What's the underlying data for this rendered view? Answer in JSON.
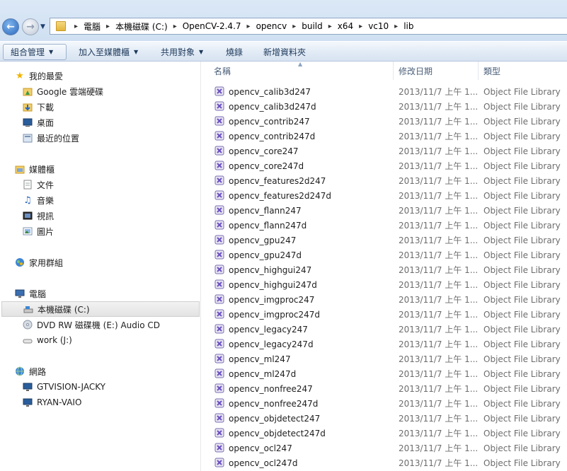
{
  "breadcrumb": [
    "電腦",
    "本機磁碟 (C:)",
    "OpenCV-2.4.7",
    "opencv",
    "build",
    "x64",
    "vc10",
    "lib"
  ],
  "toolbar": {
    "organize": "組合管理",
    "add_to_library": "加入至媒體櫃",
    "share_with": "共用對象",
    "burn": "燒錄",
    "new_folder": "新增資料夾"
  },
  "nav": {
    "favorites": {
      "label": "我的最愛",
      "items": [
        "Google 雲端硬碟",
        "下載",
        "桌面",
        "最近的位置"
      ]
    },
    "libraries": {
      "label": "媒體櫃",
      "items": [
        "文件",
        "音樂",
        "視訊",
        "圖片"
      ]
    },
    "homegroup": {
      "label": "家用群組"
    },
    "computer": {
      "label": "電腦",
      "items": [
        "本機磁碟 (C:)",
        "DVD RW 磁碟機 (E:) Audio CD",
        "work (J:)"
      ]
    },
    "network": {
      "label": "網路",
      "items": [
        "GTVISION-JACKY",
        "RYAN-VAIO"
      ]
    }
  },
  "columns": {
    "name": "名稱",
    "date": "修改日期",
    "type": "類型"
  },
  "files": [
    {
      "name": "opencv_calib3d247",
      "date": "2013/11/7 上午 1...",
      "type": "Object File Library"
    },
    {
      "name": "opencv_calib3d247d",
      "date": "2013/11/7 上午 1...",
      "type": "Object File Library"
    },
    {
      "name": "opencv_contrib247",
      "date": "2013/11/7 上午 1...",
      "type": "Object File Library"
    },
    {
      "name": "opencv_contrib247d",
      "date": "2013/11/7 上午 1...",
      "type": "Object File Library"
    },
    {
      "name": "opencv_core247",
      "date": "2013/11/7 上午 1...",
      "type": "Object File Library"
    },
    {
      "name": "opencv_core247d",
      "date": "2013/11/7 上午 1...",
      "type": "Object File Library"
    },
    {
      "name": "opencv_features2d247",
      "date": "2013/11/7 上午 1...",
      "type": "Object File Library"
    },
    {
      "name": "opencv_features2d247d",
      "date": "2013/11/7 上午 1...",
      "type": "Object File Library"
    },
    {
      "name": "opencv_flann247",
      "date": "2013/11/7 上午 1...",
      "type": "Object File Library"
    },
    {
      "name": "opencv_flann247d",
      "date": "2013/11/7 上午 1...",
      "type": "Object File Library"
    },
    {
      "name": "opencv_gpu247",
      "date": "2013/11/7 上午 1...",
      "type": "Object File Library"
    },
    {
      "name": "opencv_gpu247d",
      "date": "2013/11/7 上午 1...",
      "type": "Object File Library"
    },
    {
      "name": "opencv_highgui247",
      "date": "2013/11/7 上午 1...",
      "type": "Object File Library"
    },
    {
      "name": "opencv_highgui247d",
      "date": "2013/11/7 上午 1...",
      "type": "Object File Library"
    },
    {
      "name": "opencv_imgproc247",
      "date": "2013/11/7 上午 1...",
      "type": "Object File Library"
    },
    {
      "name": "opencv_imgproc247d",
      "date": "2013/11/7 上午 1...",
      "type": "Object File Library"
    },
    {
      "name": "opencv_legacy247",
      "date": "2013/11/7 上午 1...",
      "type": "Object File Library"
    },
    {
      "name": "opencv_legacy247d",
      "date": "2013/11/7 上午 1...",
      "type": "Object File Library"
    },
    {
      "name": "opencv_ml247",
      "date": "2013/11/7 上午 1...",
      "type": "Object File Library"
    },
    {
      "name": "opencv_ml247d",
      "date": "2013/11/7 上午 1...",
      "type": "Object File Library"
    },
    {
      "name": "opencv_nonfree247",
      "date": "2013/11/7 上午 1...",
      "type": "Object File Library"
    },
    {
      "name": "opencv_nonfree247d",
      "date": "2013/11/7 上午 1...",
      "type": "Object File Library"
    },
    {
      "name": "opencv_objdetect247",
      "date": "2013/11/7 上午 1...",
      "type": "Object File Library"
    },
    {
      "name": "opencv_objdetect247d",
      "date": "2013/11/7 上午 1...",
      "type": "Object File Library"
    },
    {
      "name": "opencv_ocl247",
      "date": "2013/11/7 上午 1...",
      "type": "Object File Library"
    },
    {
      "name": "opencv_ocl247d",
      "date": "2013/11/7 上午 1...",
      "type": "Object File Library"
    }
  ]
}
